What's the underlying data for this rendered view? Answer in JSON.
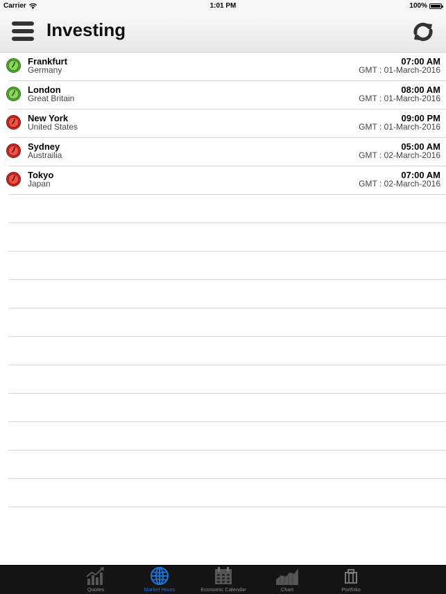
{
  "status_bar": {
    "carrier": "Carrier",
    "time": "1:01 PM",
    "battery": "100%"
  },
  "nav": {
    "title": "Investing",
    "menu_icon": "hamburger-menu-icon",
    "refresh_icon": "refresh-icon"
  },
  "markets": [
    {
      "city": "Frankfurt",
      "country": "Germany",
      "time": "07:00 AM",
      "date": "GMT : 01-March-2016",
      "status": "open",
      "color": "#4caf2a"
    },
    {
      "city": "London",
      "country": "Great Britain",
      "time": "08:00 AM",
      "date": "GMT : 01-March-2016",
      "status": "open",
      "color": "#4caf2a"
    },
    {
      "city": "New York",
      "country": "United States",
      "time": "09:00 PM",
      "date": "GMT : 01-March-2016",
      "status": "closed",
      "color": "#d9261c"
    },
    {
      "city": "Sydney",
      "country": "Austrailia",
      "time": "05:00 AM",
      "date": "GMT : 02-March-2016",
      "status": "closed",
      "color": "#d9261c"
    },
    {
      "city": "Tokyo",
      "country": "Japan",
      "time": "07:00 AM",
      "date": "GMT : 02-March-2016",
      "status": "closed",
      "color": "#d9261c"
    }
  ],
  "tabs": [
    {
      "label": "Quotes",
      "icon": "quotes-chart-icon",
      "active": false
    },
    {
      "label": "Market Hours",
      "icon": "globe-icon",
      "active": true
    },
    {
      "label": "Economic Calendar",
      "icon": "calendar-icon",
      "active": false
    },
    {
      "label": "Chart",
      "icon": "area-chart-icon",
      "active": false
    },
    {
      "label": "Portfolio",
      "icon": "briefcase-icon",
      "active": false
    }
  ],
  "colors": {
    "active_tab": "#1a73d9",
    "inactive_tab": "#8c8c8c",
    "tab_bar_bg": "#141414",
    "open_market": "#4caf2a",
    "closed_market": "#d9261c"
  }
}
